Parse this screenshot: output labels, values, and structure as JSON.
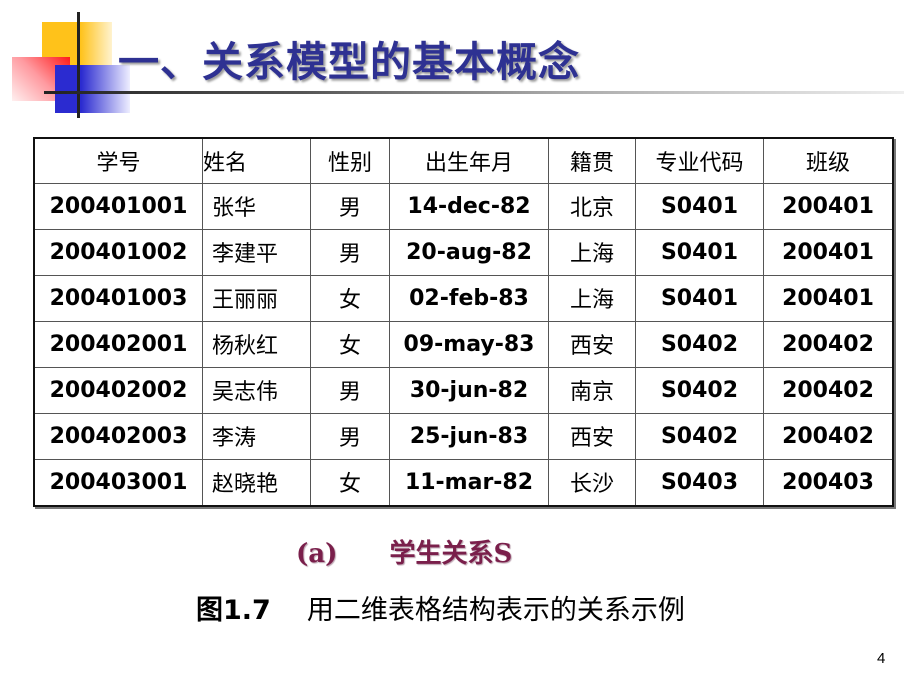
{
  "slide": {
    "title": "一、关系模型的基本概念",
    "page_number": "4",
    "colors": {
      "title": "#2e3192",
      "caption_accent": "#7a1f4b",
      "logo_yellow": "#ffc21a",
      "logo_red": "#ff1a1a",
      "logo_blue": "#2b2bd0"
    }
  },
  "table": {
    "headers": [
      "学号",
      "姓名",
      "性别",
      "出生年月",
      "籍贯",
      "专业代码",
      "班级"
    ],
    "rows": [
      [
        "200401001",
        "张华",
        "男",
        "14-dec-82",
        "北京",
        "S0401",
        "200401"
      ],
      [
        "200401002",
        "李建平",
        "男",
        "20-aug-82",
        "上海",
        "S0401",
        "200401"
      ],
      [
        "200401003",
        "王丽丽",
        "女",
        "02-feb-83",
        "上海",
        "S0401",
        "200401"
      ],
      [
        "200402001",
        "杨秋红",
        "女",
        "09-may-83",
        "西安",
        "S0402",
        "200402"
      ],
      [
        "200402002",
        "吴志伟",
        "男",
        "30-jun-82",
        "南京",
        "S0402",
        "200402"
      ],
      [
        "200402003",
        "李涛",
        "男",
        "25-jun-83",
        "西安",
        "S0402",
        "200402"
      ],
      [
        "200403001",
        "赵晓艳",
        "女",
        "11-mar-82",
        "长沙",
        "S0403",
        "200403"
      ]
    ]
  },
  "captions": {
    "sub_label": "(a)",
    "sub_title": "学生关系S",
    "figure_label": "图1.7",
    "figure_title": "用二维表格结构表示的关系示例"
  }
}
